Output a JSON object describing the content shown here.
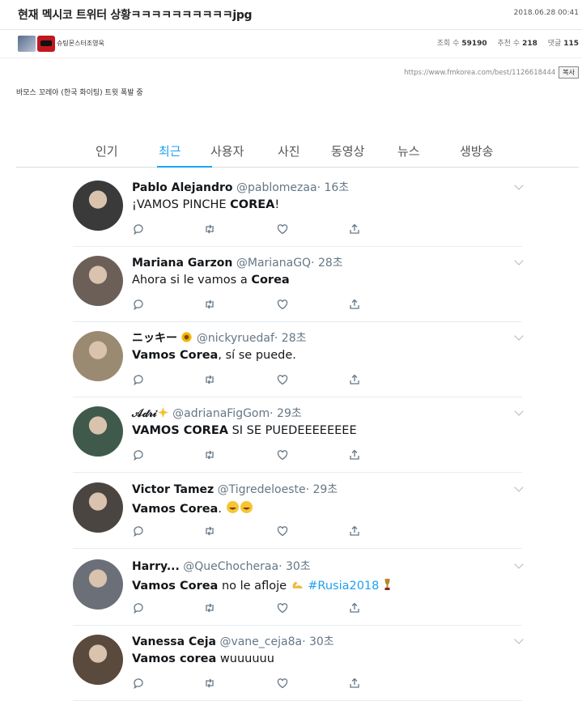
{
  "post": {
    "title": "현재 멕시코 트위터 상황ㅋㅋㅋㅋㅋㅋㅋㅋㅋㅋjpg",
    "date": "2018.06.28 00:41",
    "nickname": "슈팅몬스터조영욱",
    "views_label": "조회 수",
    "views": "59190",
    "likes_label": "추천 수",
    "likes": "218",
    "comments_label": "댓글",
    "comments": "115",
    "url": "https://www.fmkorea.com/best/1126618444",
    "copy_label": "복사",
    "intro_text": "바모스 꼬레아 (한국 화이팅) 트윗 폭발 중"
  },
  "tabs": [
    "인기",
    "최근",
    "사용자",
    "사진",
    "동영상",
    "뉴스",
    "생방송"
  ],
  "active_tab": "최근",
  "tweets": [
    {
      "name": "Pablo Alejandro",
      "handle": "@pablomezaa",
      "time": "· 16초",
      "pre": "¡VAMOS PINCHE ",
      "bold": "COREA",
      "post": "!",
      "avatar_color": "#3a3a3a"
    },
    {
      "name": "Mariana Garzon",
      "handle": "@MarianaGQ",
      "time": "· 28초",
      "pre": "Ahora si le vamos a ",
      "bold": "Corea",
      "post": "",
      "avatar_color": "#6b5f58"
    },
    {
      "name": "ニッキー",
      "handle": "@nickyruedaf",
      "time": "· 28초",
      "pre": "",
      "bold": "Vamos Corea",
      "post": ", sí se puede.",
      "avatar_color": "#9b8a72"
    },
    {
      "name": "𝒜𝒹𝓇𝒾",
      "handle": "@adrianaFigGom",
      "time": "· 29초",
      "pre": "",
      "bold": "VAMOS COREA",
      "post": " SI SE PUEDEEEEEEEE",
      "avatar_color": "#3f5a4a"
    },
    {
      "name": "Victor Tamez",
      "handle": "@Tigredeloeste",
      "time": "· 29초",
      "pre": "",
      "bold": "Vamos Corea",
      "post": ". ",
      "avatar_color": "#4a4540"
    },
    {
      "name": "Harry...",
      "handle": "@QueChocheraa",
      "time": "· 30초",
      "pre": "",
      "bold": "Vamos Corea",
      "post": " no le afloje ",
      "tag": "#Rusia2018",
      "avatar_color": "#6a6f78"
    },
    {
      "name": "Vanessa Ceja",
      "handle": "@vane_ceja8a",
      "time": "· 30초",
      "pre": "",
      "bold": "Vamos corea",
      "post": " wuuuuuu",
      "avatar_color": "#5a4a3e"
    }
  ],
  "icons": [
    "reply-icon",
    "retweet-icon",
    "like-icon",
    "share-icon",
    "chevron-down-icon"
  ],
  "colors": {
    "accent": "#1da1f2",
    "handle": "#657786",
    "divider": "#e6ecf0"
  }
}
